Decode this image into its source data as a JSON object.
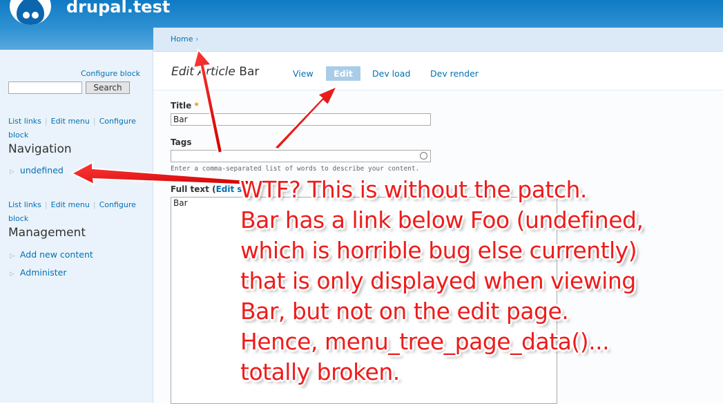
{
  "header": {
    "site_name": "drupal.test"
  },
  "search_block": {
    "configure": "Configure block",
    "button": "Search",
    "value": ""
  },
  "navigation_block": {
    "links": [
      "List links",
      "Edit menu",
      "Configure"
    ],
    "links_wrap": "block",
    "title": "Navigation",
    "items": [
      "undefined"
    ]
  },
  "management_block": {
    "links": [
      "List links",
      "Edit menu",
      "Configure"
    ],
    "links_wrap": "block",
    "title": "Management",
    "items": [
      "Add new content",
      "Administer"
    ]
  },
  "breadcrumb": {
    "home": "Home",
    "sep": "›"
  },
  "page": {
    "title_italic": "Edit Article",
    "title_rest": "Bar",
    "tabs": [
      {
        "label": "View",
        "active": false
      },
      {
        "label": "Edit",
        "active": true
      },
      {
        "label": "Dev load",
        "active": false
      },
      {
        "label": "Dev render",
        "active": false
      }
    ]
  },
  "form": {
    "title_label": "Title",
    "required_mark": "*",
    "title_value": "Bar",
    "tags_label": "Tags",
    "tags_value": "",
    "tags_help": "Enter a comma-separated list of words to describe your content.",
    "fulltext_label": "Full text (",
    "fulltext_link": "Edit s",
    "fulltext_value": "Bar"
  },
  "annotation": {
    "text": "WTF?  This is without the patch.\nBar has a link below Foo (undefined,\nwhich is horrible bug else currently)\nthat is only displayed when viewing\nBar, but not on the edit page.\nHence, menu_tree_page_data()...\ntotally broken.",
    "color": "#ee1c1c"
  },
  "colors": {
    "header_blue": "#2e91d2",
    "link": "#0071b3",
    "sidebar_bg": "#eaf3fb"
  }
}
